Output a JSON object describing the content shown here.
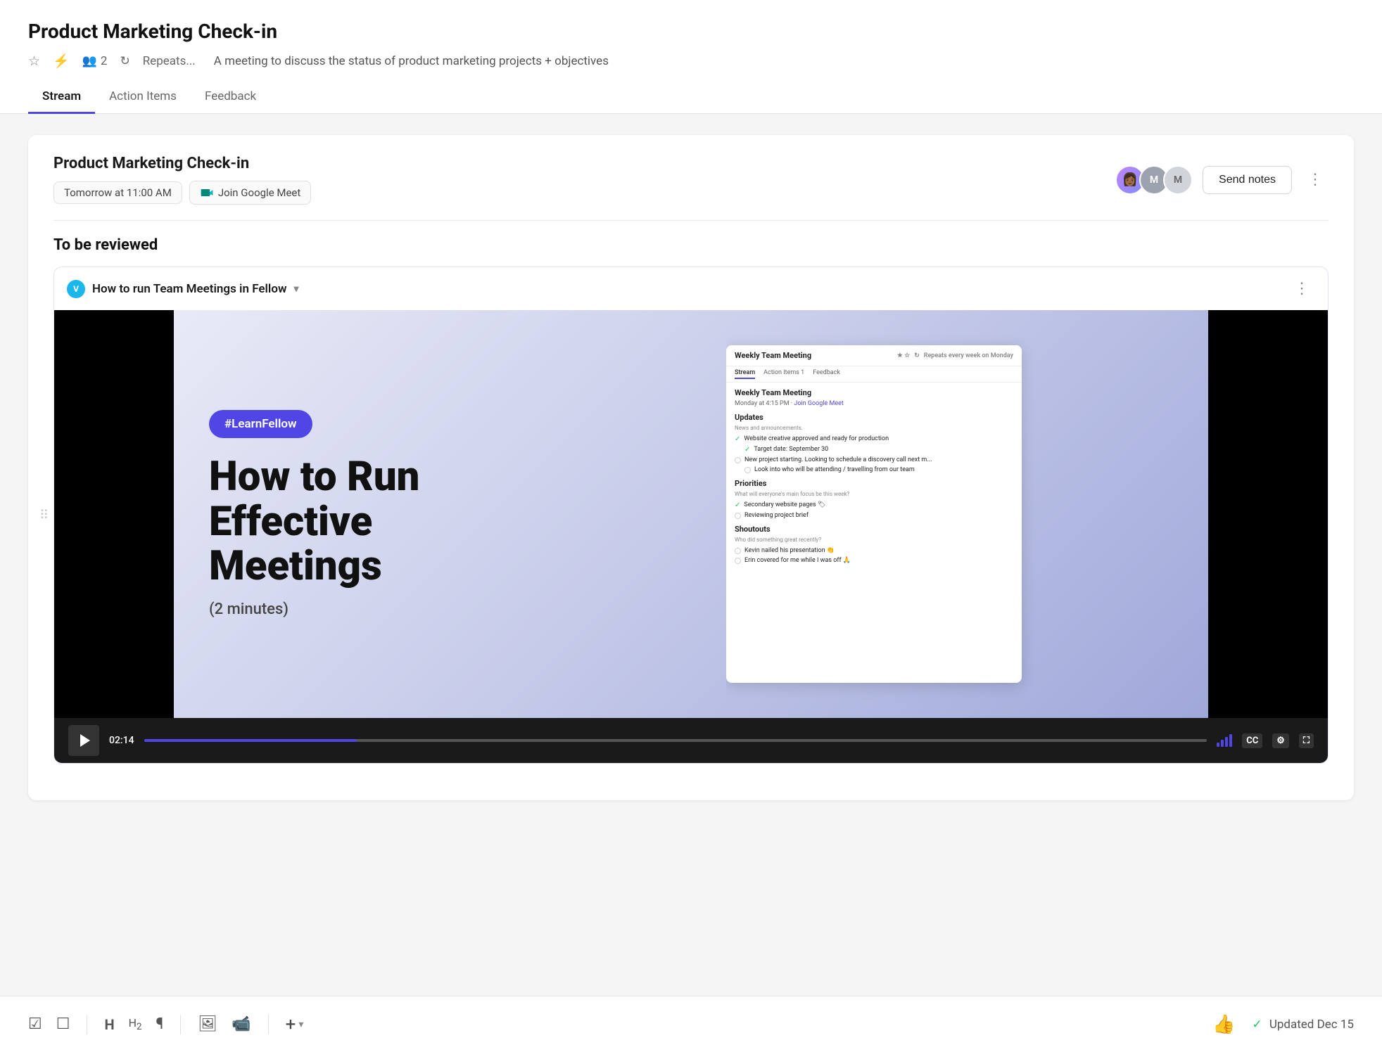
{
  "header": {
    "title": "Product Marketing Check-in",
    "meta": {
      "attendee_count": "2",
      "repeats_label": "Repeats...",
      "description": "A meeting to discuss the status of product marketing projects + objectives"
    },
    "tabs": [
      {
        "id": "stream",
        "label": "Stream",
        "active": true
      },
      {
        "id": "action-items",
        "label": "Action Items",
        "active": false
      },
      {
        "id": "feedback",
        "label": "Feedback",
        "active": false
      }
    ]
  },
  "meeting_card": {
    "title": "Product Marketing Check-in",
    "time_badge": "Tomorrow at 11:00 AM",
    "join_label": "Join Google Meet",
    "send_notes_label": "Send notes",
    "avatars": [
      {
        "id": "avatar1",
        "type": "image",
        "emoji": "👩🏾"
      },
      {
        "id": "avatar2",
        "type": "initial",
        "initial": "M",
        "color": "#9ca3af"
      },
      {
        "id": "avatar3",
        "type": "initial",
        "initial": "M",
        "color": "#d1d5db"
      }
    ]
  },
  "to_be_reviewed": {
    "section_title": "To be reviewed",
    "video_card": {
      "title": "How to run Team Meetings in Fellow",
      "vimeo_label": "V",
      "hashtag": "#LearnFellow",
      "main_title_line1": "How to Run",
      "main_title_line2": "Effective",
      "main_title_line3": "Meetings",
      "duration_label": "(2 minutes)",
      "time_code": "02:14",
      "app_screenshot": {
        "meeting_title": "Weekly Team Meeting",
        "meeting_meta": "Monday at 4:15 PM · Join Google Meet",
        "nav_items": [
          "Stream",
          "Action Items 1",
          "Feedback"
        ],
        "sections": [
          {
            "title": "Updates",
            "subtitle": "News and announcements.",
            "items": [
              {
                "checked": true,
                "text": "Website creative approved and ready for production"
              },
              {
                "checked": true,
                "text": "Target date: September 30"
              },
              {
                "checked": false,
                "text": "New project starting. Looking to schedule a discovery call next m..."
              },
              {
                "checked": false,
                "text": "Look into who will be attending / travelling from our team"
              }
            ]
          },
          {
            "title": "Priorities",
            "subtitle": "What will everyone's main focus be this week?",
            "items": [
              {
                "checked": true,
                "text": "Secondary website pages",
                "has_flag": true
              },
              {
                "checked": false,
                "text": "Reviewing project brief"
              }
            ]
          },
          {
            "title": "Shoutouts",
            "subtitle": "Who did something great recently?",
            "items": [
              {
                "checked": false,
                "text": "Kevin nailed his presentation 👏"
              },
              {
                "checked": false,
                "text": "Erin covered for me while I was off 🙏"
              }
            ]
          }
        ]
      }
    }
  },
  "toolbar": {
    "icons": [
      {
        "name": "circle-check-icon",
        "symbol": "☑"
      },
      {
        "name": "checkbox-icon",
        "symbol": "☐"
      },
      {
        "name": "heading1-icon",
        "symbol": "H"
      },
      {
        "name": "heading2-icon",
        "symbol": "H2"
      },
      {
        "name": "paragraph-icon",
        "symbol": "¶"
      },
      {
        "name": "image-icon",
        "symbol": "▣"
      },
      {
        "name": "video-icon",
        "symbol": "▶"
      },
      {
        "name": "add-icon",
        "symbol": "+"
      }
    ],
    "updated_text": "Updated Dec 15"
  }
}
